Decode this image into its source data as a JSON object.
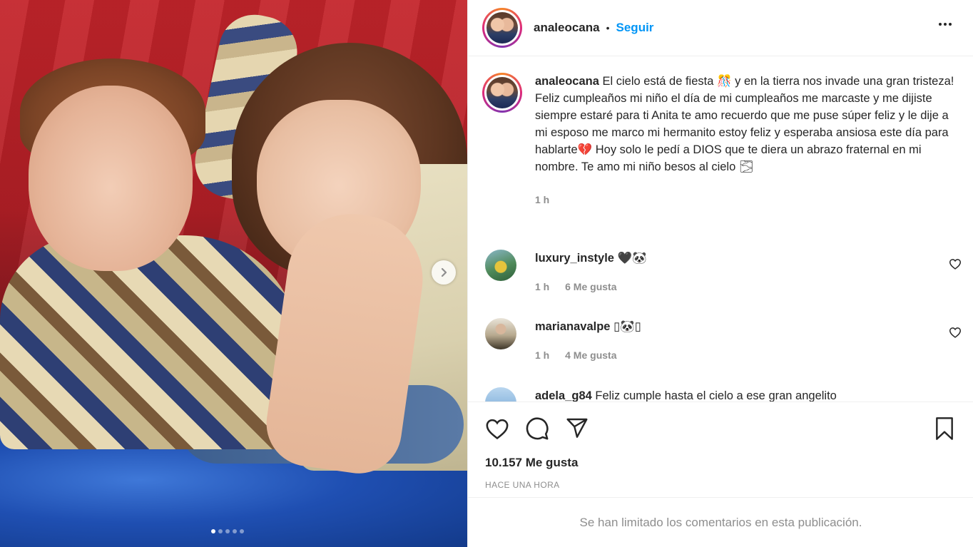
{
  "post": {
    "username": "analeocana",
    "separator": "•",
    "follow_label": "Seguir",
    "carousel_count": 5,
    "carousel_active_index": 0
  },
  "caption": {
    "username": "analeocana",
    "text": "El cielo está de fiesta 🎊 y en la tierra nos invade una gran tristeza! Feliz cumpleaños mi niño el día de mi cumpleaños me marcaste y me dijiste siempre estaré para ti Anita te amo recuerdo que me puse súper feliz y le dije a mi esposo me marco mi hermanito estoy feliz y esperaba ansiosa este día para hablarte💔 Hoy solo le pedí a DIOS que te diera un abrazo fraternal en mi nombre. Te amo mi niño besos al cielo 🌫",
    "time": "1 h"
  },
  "comments": [
    {
      "username": "luxury_instyle",
      "text": "🖤🐼",
      "time": "1 h",
      "likes": "6 Me gusta"
    },
    {
      "username": "marianavalpe",
      "text": "▯🐼▯",
      "time": "1 h",
      "likes": "4 Me gusta"
    },
    {
      "username": "adela_g84",
      "text": "Feliz cumple hasta el cielo a ese gran angelito"
    }
  ],
  "footer": {
    "likes_count": "10.157 Me gusta",
    "time_ago": "HACE UNA HORA",
    "comments_limited": "Se han limitado los comentarios en esta publicación."
  },
  "icons": {
    "like": "heart-icon",
    "comment": "comment-icon",
    "share": "share-icon",
    "save": "bookmark-icon",
    "more": "more-options-icon",
    "next": "chevron-right-icon"
  },
  "colors": {
    "accent": "#0095f6",
    "text": "#262626",
    "muted": "#8e8e8e",
    "border": "#efefef"
  }
}
